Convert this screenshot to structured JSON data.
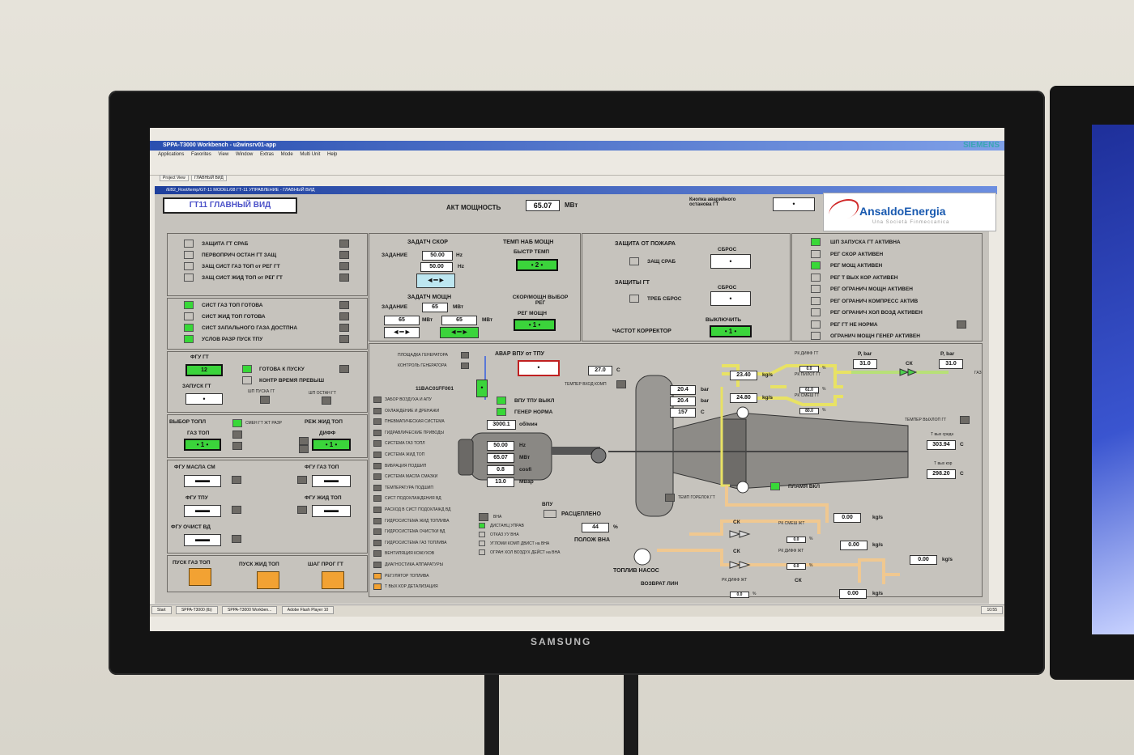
{
  "window": {
    "title": "SPPA-T3000 Workbench - u2winsrv01-app",
    "brand": "SIEMENS"
  },
  "menu": [
    "Applications",
    "Favorites",
    "View",
    "Window",
    "Extras",
    "Mode",
    "Multi Unit",
    "Help"
  ],
  "tabs": [
    "Project View",
    "ГЛАВНЫЙ ВИД"
  ],
  "inner_title": "/EB2_Root/temp/GT-11 MODEL/08 ГТ-11 УПРАВЛЕНИЕ - ГЛАВНЫЙ ВИД",
  "header": {
    "view_title": "ГТ11 ГЛАВНЫЙ ВИД",
    "power_label": "АКТ МОЩНОСТЬ",
    "power_value": "65.07",
    "power_unit": "МВт",
    "emergency_label": "Кнопка аварийного останова ГТ",
    "logo_text": "AnsaldoEnergia",
    "logo_sub": "Una Società Finmeccanica",
    "monitor_brand": "SAMSUNG"
  },
  "left_status": {
    "group1": [
      "ЗАЩИТА ГТ СРАБ",
      "ПЕРВОПРИЧ ОСТАН ГТ ЗАЩ",
      "ЗАЩ СИСТ ГАЗ ТОП от РЕГ ГТ",
      "ЗАЩ СИСТ ЖИД ТОП от РЕГ ГТ"
    ],
    "group2": [
      "СИСТ ГАЗ ТОП ГОТОВА",
      "СИСТ ЖИД ТОП ГОТОВА",
      "СИСТ ЗАПАЛЬНОГО ГАЗА ДОСТПНА",
      "УСЛОВ РАЗР ПУСК ТПУ"
    ],
    "fgu_gt": "ФГУ ГТ",
    "fgu_gt_value": "12",
    "ready_label": "ГОТОВА К ПУСКУ",
    "time_label": "КОНТР ВРЕМЯ ПРЕВЫШ",
    "start_gt": "ЗАПУСК ГТ",
    "shp_pusk": "ШП ПУСКА ГТ",
    "shp_ostan": "ШП ОСТАН ГТ",
    "fuel_select": "ВЫБОР ТОПЛ",
    "change_fuel": "СМЕН ГТ ЖТ РАЗР",
    "mode_liquid": "РЕЖ ЖИД ТОП",
    "gas_top": "ГАЗ ТОП",
    "diff": "ДИФФ",
    "fgu_oil": "ФГУ МАСЛА СМ",
    "fgu_gas": "ФГУ ГАЗ ТОП",
    "fgu_tpu": "ФГУ ТПУ",
    "fgu_liquid": "ФГУ ЖИД ТОП",
    "fgu_clean": "ФГУ ОЧИСТ ВД",
    "btn_gas_start": "ПУСК ГАЗ ТОП",
    "btn_liquid_start": "ПУСК ЖИД ТОП",
    "btn_step": "ШАГ ПРОГ ГТ"
  },
  "speed": {
    "title": "ЗАДАТЧ СКОР",
    "setpoint_label": "ЗАДАНИЕ",
    "setpoint": "50.00",
    "actual": "50.00",
    "unit": "Hz",
    "temp_title": "ТЕМП НАБ МОЩН",
    "temp_sub": "БЫСТР ТЕМП",
    "temp_value": "2"
  },
  "power": {
    "title": "ЗАДАТЧ МОЩН",
    "setpoint_label": "ЗАДАНИЕ",
    "setpoint": "65",
    "unit": "МВт",
    "val1": "65",
    "val2": "65",
    "mode_title": "СКОР/МОЩН ВЫБОР РЕГ",
    "mode_sub": "РЕГ МОЩН",
    "mode_value": "1"
  },
  "protection": {
    "fire_title": "ЗАЩИТА ОТ ПОЖАРА",
    "fire_item": "ЗАЩ СРАБ",
    "reset": "СБРОС",
    "gt_title": "ЗАЩИТЫ ГТ",
    "gt_item": "ТРЕБ СБРОС",
    "freq_label": "ЧАСТОТ КОРРЕКТОР",
    "off_label": "ВЫКЛЮЧИТЬ",
    "freq_value": "1"
  },
  "right_status": [
    "ШП ЗАПУСКА ГТ АКТИВНА",
    "РЕГ СКОР АКТИВЕН",
    "РЕГ МОЩ АКТИВЕН",
    "РЕГ Т ВЫХ КОР АКТИВЕН",
    "РЕГ ОГРАНИЧ МОЩН АКТИВЕН",
    "РЕГ ОГРАНИЧ КОМПРЕСС АКТИВ",
    "РЕГ ОГРАНИЧ ХОЛ ВОЗД АКТИВЕН",
    "РЕГ ГТ НЕ НОРМА",
    "ОГРАНИЧ МОЩН ГЕНЕР АКТИВЕН"
  ],
  "right_status_on": [
    true,
    false,
    true,
    false,
    false,
    false,
    false,
    false,
    false
  ],
  "process": {
    "sys_list": [
      "ПЛОЩАДКА ГЕНЕРАТОРА",
      "КОНТРОЛЬ ГЕНЕРАТОРА",
      "ЗАБОР ВОЗДУХА И АПУ",
      "ОХЛАЖДЕНИЕ И ДРЕНАЖИ",
      "ПНЕВМАТИЧЕСКАЯ СИСТЕМА",
      "ГИДРАВЛИЧЕСКИЕ ПРИВОДЫ",
      "СИСТЕМА ГАЗ ТОПЛ",
      "СИСТЕМА ЖИД ТОП",
      "ВИБРАЦИЯ ПОДШИП",
      "СИСТЕМА МАСЛА СМАЗКИ",
      "ТЕМПЕРАТУРА ПОДШИП",
      "СИСТ ПОДОХЛАЖДЕНИЯ ВД",
      "РАСХОД В СИСТ ПОДОХЛАЖД ВД",
      "ГИДРОСИСТЕМА ЖИД ТОПЛИВА",
      "ГИДРОСИСТЕМА ОЧИСТКИ ВД",
      "ГИДРОСИСТЕМА ГАЗ ТОПЛИВА",
      "ВЕНТИЛЯЦИЯ КОЖУХОВ",
      "ДИАГНОСТИКА АППАРАТУРЫ",
      "РЕГУЛЯТОР ТОПЛИВА",
      "Т ВЫХ КОР ДЕТАЛИЗАЦИЯ"
    ],
    "alarm_tpu": "АВАР ВПУ от ТПУ",
    "tag": "11BAC01FF001",
    "tpu_off": "ВПУ ТПУ ВЫКЛ",
    "gen_ok": "ГЕНЕР НОРМА",
    "rpm": "3000.1",
    "rpm_unit": "об/мин",
    "gen_hz": "50.00",
    "gen_mw": "65.07",
    "gen_cos": "0.8",
    "gen_mvar": "13.0",
    "u_hz": "Hz",
    "u_mw": "МВт",
    "u_cos": "cosfi",
    "u_mvar": "МВар",
    "vpu": "ВПУ",
    "disengaged": "РАСЦЕПЛЕНО",
    "vna_pos": "ПОЛОЖ ВНА",
    "vna_value": "44",
    "vna_unit": "%",
    "vna": "ВНА",
    "dist": "ДИСТАНЦ УПРАВ",
    "vna_note1": "ОТКАЗ УУ ВНА",
    "vna_note2": "УГЛОМИ КОМП ДВИСТ на ВНА",
    "vna_note3": "ОГРАН ХОЛ ВОЗДУХ ДЕЙСТ на ВНА",
    "inlet_temp_label": "ТЕМПЕР ВХОД КОМП",
    "inlet_temp": "27.0",
    "inlet_unit": "С",
    "p1": "20.4",
    "p2": "20.4",
    "t1": "157",
    "bar": "bar",
    "c": "С",
    "flow1": "23.40",
    "flow2": "24.80",
    "kgs": "kg/s",
    "rk_diff_gt": "РК ДИФФ ГТ",
    "rk_pilot_gt": "РК ПИЛОТ ГТ",
    "rk_mix_gt": "РК СМЕШ ГТ",
    "rk1": "0.0",
    "rk2": "61.0",
    "rk3": "80.0",
    "pct": "%",
    "pbar1": "P, bar",
    "pbar2": "P, bar",
    "pval1": "31.0",
    "pval2": "31.0",
    "sk": "СК",
    "gas_in": "ГАЗ",
    "exh_temp_label": "ТЕМПЕР ВЫХЛОП ГТ",
    "t_exh_avg": "Т вых средн",
    "t_exh_avg_val": "303.94",
    "t_exh_cor": "Т вых кор",
    "t_exh_cor_val": "298.20",
    "flame": "ПЛАМЯ ВКЛ",
    "burner_temp": "ТЕМП ГОРЕЛОК ГТ",
    "liq_flows": [
      "0.00",
      "0.00",
      "0.00",
      "0.00"
    ],
    "rk_mix_zht": "РК СМЕШ ЖТ",
    "rk_diff_zht": "РК ДИФФ ЖТ",
    "rk_zht1": "0.0",
    "rk_zht2": "0.0",
    "rk_zht3": "0.0",
    "pump": "ТОПЛИВ НАСОС",
    "return": "ВОЗВРАТ ЛИН"
  },
  "taskbar": {
    "start": "Start",
    "items": [
      "SPPA-T3000 (tb)",
      "SPPA-T3000 Workben...",
      "Adobe Flash Player 10"
    ],
    "clock": "10:55"
  }
}
